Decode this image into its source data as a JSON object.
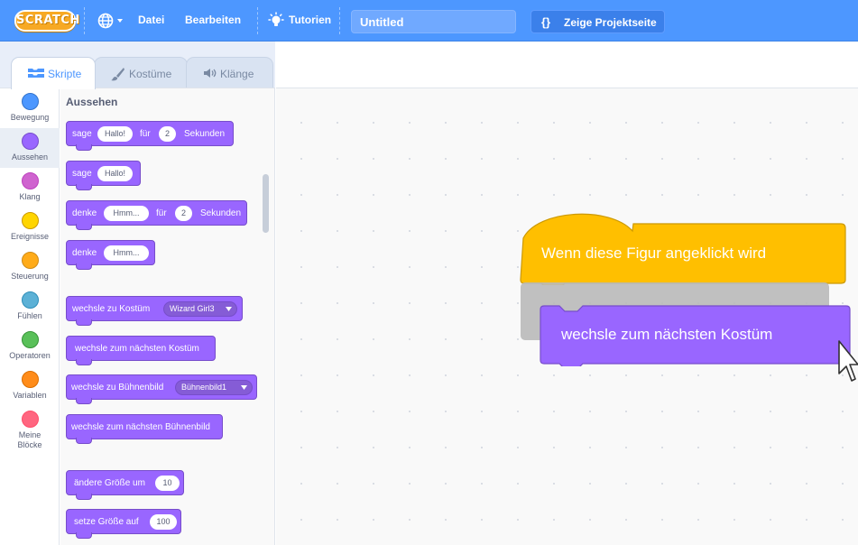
{
  "menubar": {
    "logo": "SCRATCH",
    "language_caret": "▾",
    "file": "Datei",
    "edit": "Bearbeiten",
    "tutorials": "Tutorien",
    "project_title": "Untitled",
    "project_page": "Zeige Projektseite",
    "project_page_icon": "{}"
  },
  "tabs": [
    {
      "label": "Skripte",
      "icon": "code-icon",
      "active": true
    },
    {
      "label": "Kostüme",
      "icon": "brush-icon",
      "active": false
    },
    {
      "label": "Klänge",
      "icon": "speaker-icon",
      "active": false
    }
  ],
  "categories": [
    {
      "label": "Bewegung",
      "color": "#4c97ff"
    },
    {
      "label": "Aussehen",
      "color": "#9966ff",
      "active": true
    },
    {
      "label": "Klang",
      "color": "#cf63cf"
    },
    {
      "label": "Ereignisse",
      "color": "#ffd500"
    },
    {
      "label": "Steuerung",
      "color": "#ffab19"
    },
    {
      "label": "Fühlen",
      "color": "#5cb1d6"
    },
    {
      "label": "Operatoren",
      "color": "#59c059"
    },
    {
      "label": "Variablen",
      "color": "#ff8c1a"
    },
    {
      "label": "Meine Blöcke",
      "color": "#ff6680"
    }
  ],
  "palette": {
    "heading": "Aussehen",
    "blocks": {
      "say_for": {
        "a": "sage",
        "b": "Hallo!",
        "c": "für",
        "d": "2",
        "e": "Sekunden"
      },
      "say": {
        "a": "sage",
        "b": "Hallo!"
      },
      "think_for": {
        "a": "denke",
        "b": "Hmm...",
        "c": "für",
        "d": "2",
        "e": "Sekunden"
      },
      "think": {
        "a": "denke",
        "b": "Hmm..."
      },
      "switch_costume": {
        "a": "wechsle zu Kostüm",
        "b": "Wizard Girl3"
      },
      "next_costume": {
        "a": "wechsle zum nächsten Kostüm"
      },
      "switch_backdrop": {
        "a": "wechsle zu Bühnenbild",
        "b": "Bühnenbild1"
      },
      "next_backdrop": {
        "a": "wechsle zum nächsten Bühnenbild"
      },
      "change_size": {
        "a": "ändere Größe um",
        "b": "10"
      },
      "set_size": {
        "a": "setze Größe auf",
        "b": "100"
      }
    }
  },
  "workspace": {
    "hat_block": "Wenn diese Figur angeklickt wird",
    "dragged_block": "wechsle zum nächsten Kostüm",
    "colors": {
      "events": "#ffbf00",
      "looks": "#9966ff"
    }
  }
}
